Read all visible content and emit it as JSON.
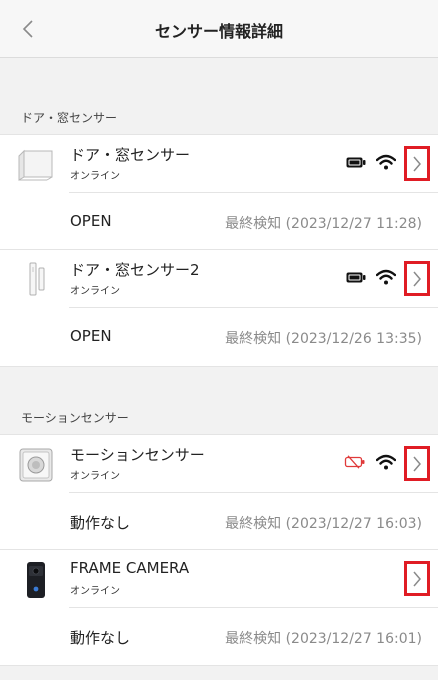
{
  "header": {
    "title": "センサー情報詳細"
  },
  "sections": [
    {
      "title": "ドア・窓センサー",
      "devices": [
        {
          "name": "ドア・窓センサー",
          "status": "オンライン",
          "state": "OPEN",
          "last_detected": "最終検知 (2023/12/27 11:28)",
          "battery": "full",
          "wifi": true
        },
        {
          "name": "ドア・窓センサー2",
          "status": "オンライン",
          "state": "OPEN",
          "last_detected": "最終検知 (2023/12/26 13:35)",
          "battery": "full",
          "wifi": true
        }
      ]
    },
    {
      "title": "モーションセンサー",
      "devices": [
        {
          "name": "モーションセンサー",
          "status": "オンライン",
          "state": "動作なし",
          "last_detected": "最終検知 (2023/12/27 16:03)",
          "battery": "low-alert",
          "wifi": true
        },
        {
          "name": "FRAME CAMERA",
          "status": "オンライン",
          "state": "動作なし",
          "last_detected": "最終検知 (2023/12/27 16:01)",
          "battery": "none",
          "wifi": false
        }
      ]
    }
  ],
  "colors": {
    "highlight_border": "#e01c24",
    "battery_alert": "#e03a3a",
    "secondary_text": "#8a8a8a"
  },
  "icons": {
    "back": "chevron-left-icon",
    "detail": "chevron-right-icon",
    "wifi": "wifi-icon",
    "battery": "battery-icon"
  }
}
